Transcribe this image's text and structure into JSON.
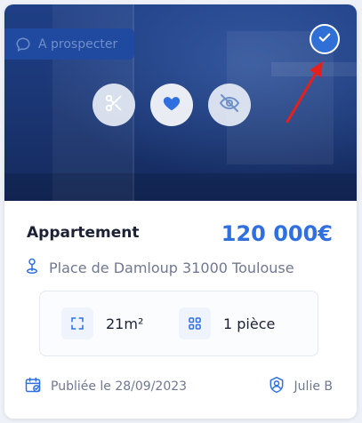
{
  "listing": {
    "status_label": "A prospecter",
    "property_type": "Appartement",
    "price": "120 000€",
    "address": "Place de Damloup 31000 Toulouse",
    "surface": "21m²",
    "rooms": "1 pièce",
    "published": "Publiée le 28/09/2023",
    "agent": "Julie B",
    "selected": true
  },
  "colors": {
    "accent": "#2f6fe0",
    "photo_overlay": "#1b3674",
    "annotation_arrow": "#e3201b"
  },
  "icons": {
    "status": "chat-bubble-icon",
    "dismiss": "scissors-icon",
    "favorite": "heart-icon",
    "hide": "eye-off-icon",
    "selected": "check-circle-icon",
    "address": "location-pin-icon",
    "surface": "expand-icon",
    "rooms": "grid-icon",
    "published": "calendar-check-icon",
    "agent": "user-badge-icon"
  }
}
